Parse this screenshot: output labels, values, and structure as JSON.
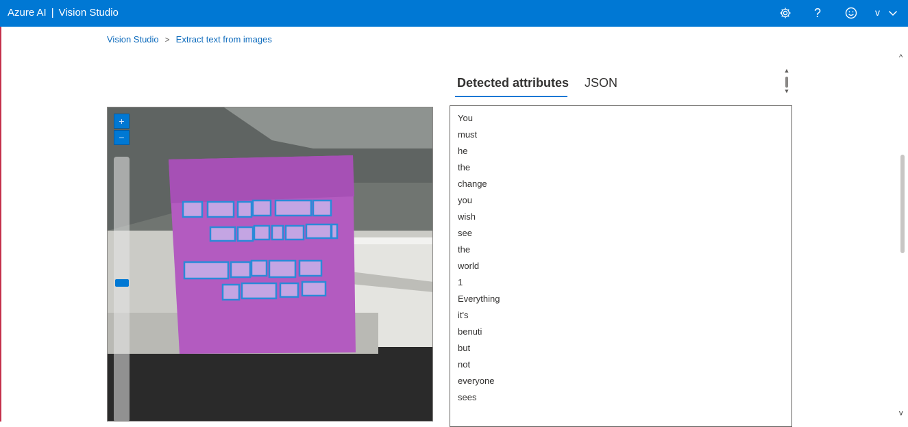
{
  "app": {
    "brand": "Azure AI",
    "separator": "|",
    "product": "Vision Studio",
    "user_initial": "v"
  },
  "header_icons": [
    "gear-icon",
    "help-icon",
    "smiley-feedback-icon",
    "chevron-down-icon"
  ],
  "breadcrumb": {
    "items": [
      "Vision Studio",
      "Extract text from images"
    ],
    "separator": ">"
  },
  "tabs": {
    "active": "Detected attributes",
    "inactive": "JSON"
  },
  "zoom": {
    "in_label": "+",
    "out_label": "−"
  },
  "detected_words": [
    "You",
    "must",
    "he",
    "the",
    "change",
    "you",
    "wish",
    "see",
    "the",
    "world",
    "1",
    "Everything",
    "it's",
    "benuti",
    "but",
    "not",
    "everyone",
    "sees"
  ],
  "colors": {
    "accent": "#0078d4",
    "header_bg": "#0078d4",
    "bounding_box": "#2b8ad8",
    "note_color": "#b35bc0"
  }
}
